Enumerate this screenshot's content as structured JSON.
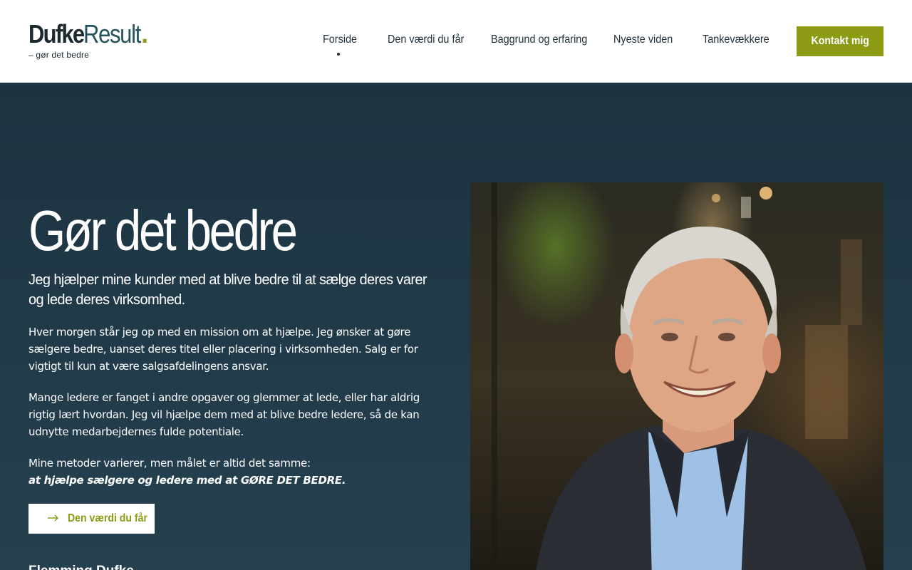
{
  "brand": {
    "name_bold": "Dufke",
    "name_light": "Result",
    "dot": ".",
    "tagline": "– gør det bedre"
  },
  "nav": {
    "items": [
      {
        "label": "Forside",
        "active": true
      },
      {
        "label": "Den værdi du får"
      },
      {
        "label": "Baggrund og erfaring"
      },
      {
        "label": "Nyeste viden"
      },
      {
        "label": "Tankevækkere"
      }
    ],
    "cta_label": "Kontakt mig"
  },
  "hero": {
    "headline": "Gør det bedre",
    "lead": "Jeg hjælper mine kunder med at blive bedre til at sælge deres varer og lede deres virksomhed.",
    "paragraph_1": "Hver morgen står jeg op med en mission om at hjælpe. Jeg ønsker at gøre sælgere bedre, uanset deres titel eller placering i virksomheden. Salg er for vigtigt til kun at være salgsafdelingens ansvar.",
    "paragraph_2": "Mange ledere er fanget i andre opgaver og glemmer at lede, eller har aldrig rigtig lært hvordan. Jeg vil hjælpe dem med at blive bedre ledere, så de kan udnytte medarbejdernes fulde potentiale.",
    "paragraph_3": "Mine metoder varierer, men målet er altid det samme:",
    "paragraph_3_emphasis": "at hjælpe sælgere og ledere med at GØRE DET BEDRE.",
    "button_label": "Den værdi du får",
    "signature": "Flemming Dufke"
  },
  "colors": {
    "accent": "#8d9a14",
    "hero_bg": "#1d3340",
    "text_dark": "#1f2e38"
  },
  "icons": {
    "button_icon": "arrow-right-icon"
  }
}
